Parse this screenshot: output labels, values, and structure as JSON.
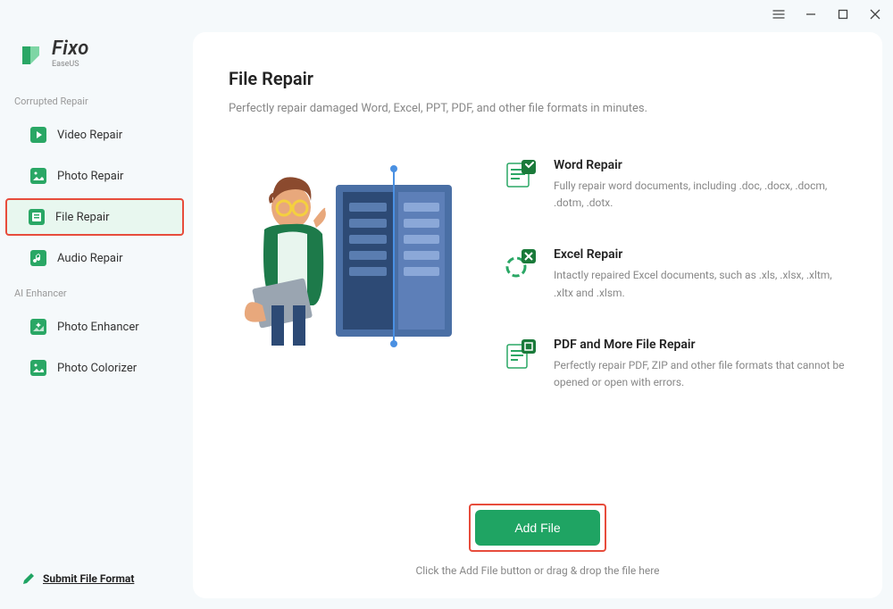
{
  "app": {
    "name": "Fixo",
    "vendor": "EaseUS"
  },
  "titlebar": {
    "menu": "≡",
    "min": "—",
    "max": "☐",
    "close": "✕"
  },
  "sidebar": {
    "sections": [
      {
        "label": "Corrupted Repair",
        "items": [
          {
            "label": "Video Repair",
            "icon": "video"
          },
          {
            "label": "Photo Repair",
            "icon": "photo"
          },
          {
            "label": "File Repair",
            "icon": "file",
            "active": true
          },
          {
            "label": "Audio Repair",
            "icon": "audio"
          }
        ]
      },
      {
        "label": "AI Enhancer",
        "items": [
          {
            "label": "Photo Enhancer",
            "icon": "enhance"
          },
          {
            "label": "Photo Colorizer",
            "icon": "colorize"
          }
        ]
      }
    ],
    "submit_label": "Submit File Format"
  },
  "main": {
    "title": "File Repair",
    "subtitle": "Perfectly repair damaged Word, Excel, PPT, PDF, and other file formats in minutes.",
    "features": [
      {
        "title": "Word Repair",
        "desc": "Fully repair word documents, including .doc, .docx, .docm, .dotm, .dotx."
      },
      {
        "title": "Excel Repair",
        "desc": "Intactly repaired Excel documents, such as .xls, .xlsx, .xltm, .xltx and .xlsm."
      },
      {
        "title": "PDF and More File Repair",
        "desc": "Perfectly repair PDF, ZIP and other file formats that cannot be opened or open with errors."
      }
    ],
    "add_file_label": "Add File",
    "hint": "Click the Add File button or drag & drop the file here"
  },
  "colors": {
    "accent": "#1fa463",
    "highlight_border": "#e74c3c"
  }
}
